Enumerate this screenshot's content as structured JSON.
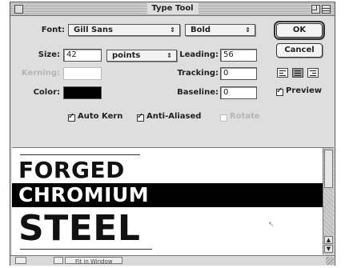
{
  "window": {
    "title": "Type Tool"
  },
  "font": {
    "label": "Font:",
    "family": "Gill Sans",
    "style": "Bold"
  },
  "size": {
    "label": "Size:",
    "value": "42",
    "unit": "points"
  },
  "leading": {
    "label": "Leading:",
    "value": "56"
  },
  "kerning": {
    "label": "Kerning:",
    "value": ""
  },
  "tracking": {
    "label": "Tracking:",
    "value": "0"
  },
  "color": {
    "label": "Color:",
    "swatch": "#000000"
  },
  "baseline": {
    "label": "Baseline:",
    "value": "0"
  },
  "buttons": {
    "ok": "OK",
    "cancel": "Cancel"
  },
  "preview_option": {
    "label": "Preview",
    "checked": true
  },
  "options": {
    "auto_kern": {
      "label": "Auto Kern",
      "checked": true
    },
    "anti_aliased": {
      "label": "Anti-Aliased",
      "checked": true
    },
    "rotate": {
      "label": "Rotate",
      "checked": false
    }
  },
  "text_preview": {
    "line1": "FORGED",
    "line2": "CHROMIUM",
    "line3": "STEEL"
  },
  "status": {
    "fit": "Fit in Window"
  }
}
